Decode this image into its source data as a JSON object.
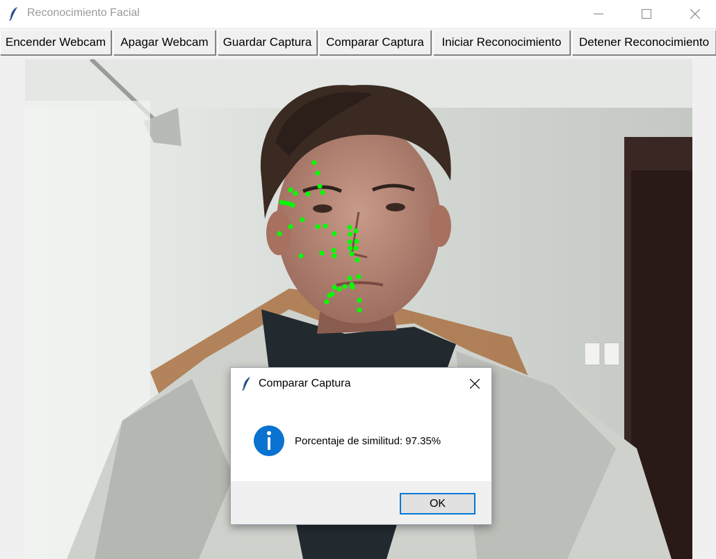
{
  "window": {
    "title": "Reconocimiento Facial",
    "icon": "feather-icon"
  },
  "toolbar": {
    "buttons": [
      {
        "label": "Encender Webcam"
      },
      {
        "label": "Apagar Webcam"
      },
      {
        "label": "Guardar Captura"
      },
      {
        "label": "Comparar Captura"
      },
      {
        "label": "Iniciar Reconocimiento"
      },
      {
        "label": "Detener Reconocimiento"
      }
    ]
  },
  "video": {
    "landmark_color": "#00ff00"
  },
  "dialog": {
    "title": "Comparar Captura",
    "icon": "info-icon",
    "message": "Porcentaje de similitud: 97.35%",
    "ok_label": "OK",
    "accent": "#0078d7"
  }
}
